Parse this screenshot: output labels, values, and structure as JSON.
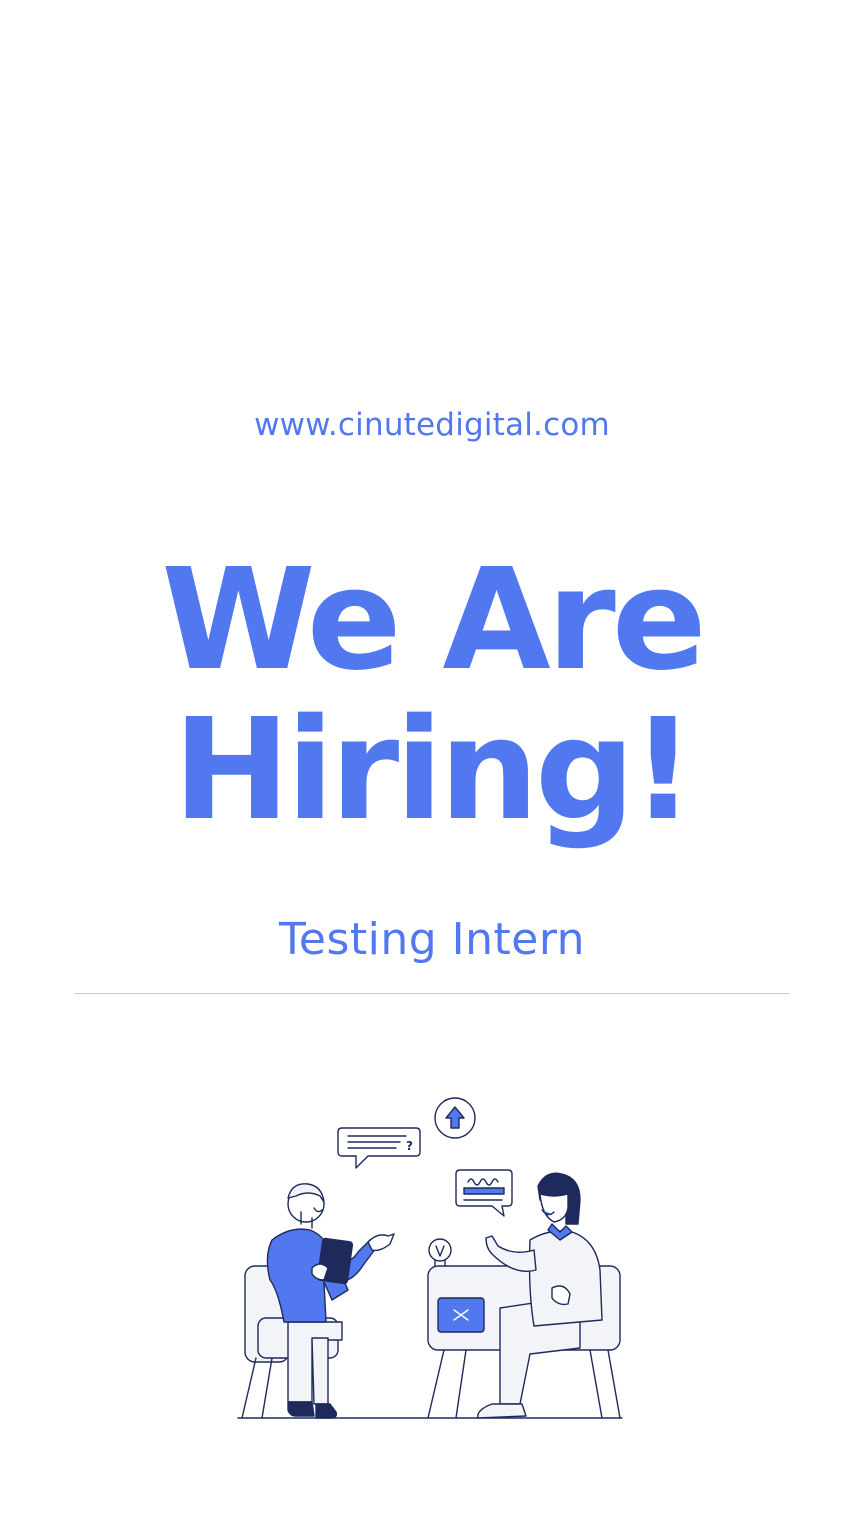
{
  "poster": {
    "website": "www.cinutedigital.com",
    "headline_line1": "We Are",
    "headline_line2": "Hiring!",
    "role": "Testing Intern"
  },
  "colors": {
    "accent": "#5178ee",
    "outline": "#1f2a5c",
    "chair_fill": "#f3f4f8",
    "background": "#ffffff"
  },
  "illustration": {
    "question_bubble_text": "?"
  }
}
